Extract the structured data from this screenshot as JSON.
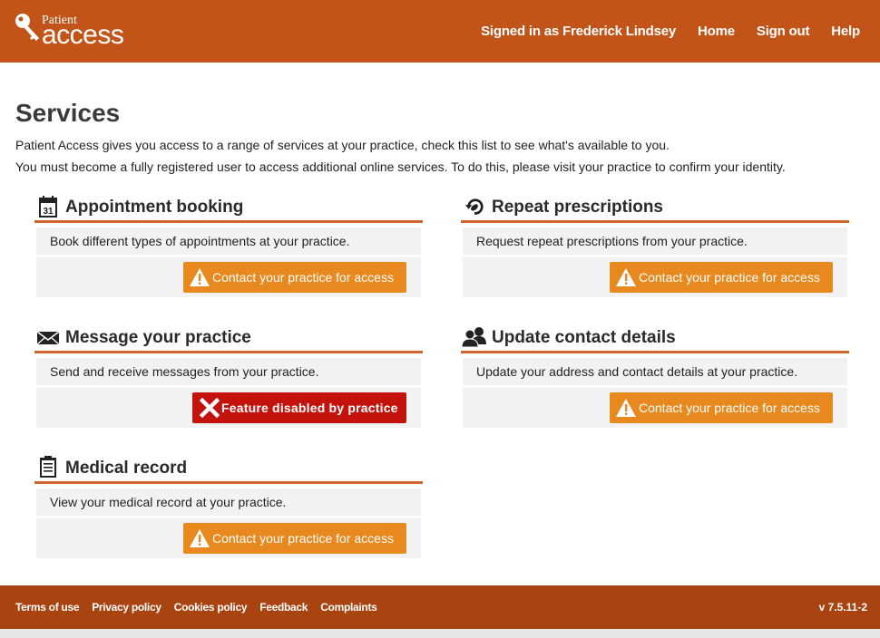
{
  "header": {
    "logo_small": "Patient",
    "logo_big": "access",
    "nav": {
      "signed_in": "Signed in as Frederick Lindsey",
      "home": "Home",
      "sign_out": "Sign out",
      "help": "Help"
    }
  },
  "page": {
    "title": "Services",
    "intro1": "Patient Access gives you access to a range of services at your practice, check this list to see what's available to you.",
    "intro2": "You must become a fully registered user to access additional online services. To do this, please visit your practice to confirm your identity."
  },
  "services": {
    "appointment": {
      "icon": "calendar-icon",
      "icon_text": "31",
      "title": "Appointment booking",
      "description": "Book different types of appointments at your practice.",
      "button": "Contact your practice for access"
    },
    "prescriptions": {
      "icon": "prescription-refresh-icon",
      "title": "Repeat prescriptions",
      "description": "Request repeat prescriptions from your practice.",
      "button": "Contact your practice for access"
    },
    "message": {
      "icon": "envelope-icon",
      "title": "Message your practice",
      "description": "Send and receive messages from your practice.",
      "button": "Feature disabled by practice"
    },
    "contact": {
      "icon": "people-icon",
      "title": "Update contact details",
      "description": "Update your address and contact details at your practice.",
      "button": "Contact your practice for access"
    },
    "record": {
      "icon": "clipboard-icon",
      "title": "Medical record",
      "description": "View your medical record at your practice.",
      "button": "Contact your practice for access"
    }
  },
  "footer": {
    "links": {
      "terms": "Terms of use",
      "privacy": "Privacy policy",
      "cookies": "Cookies policy",
      "feedback": "Feedback",
      "complaints": "Complaints"
    },
    "version": "v 7.5.11-2"
  },
  "colors": {
    "header": "#c35419",
    "footer": "#a9430f",
    "accent_rule": "#d2652b",
    "button_orange": "#e8891f",
    "button_red": "#c4120c"
  }
}
